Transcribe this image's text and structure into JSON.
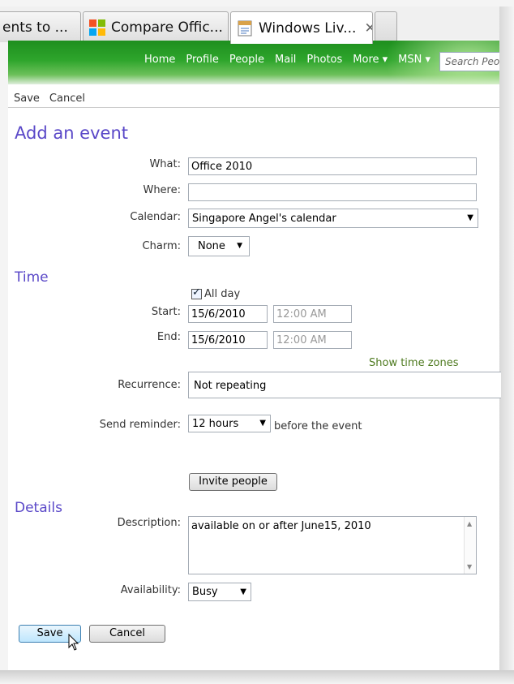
{
  "tabs": [
    {
      "title": "ents to ..."
    },
    {
      "title": "Compare Offic..."
    },
    {
      "title": "Windows Liv...",
      "close": "✕"
    }
  ],
  "nav": {
    "items": [
      "Home",
      "Profile",
      "People",
      "Mail",
      "Photos",
      "More ▾",
      "MSN ▾"
    ],
    "search_placeholder": "Search People"
  },
  "cmdbar": {
    "save": "Save",
    "cancel": "Cancel"
  },
  "page": {
    "heading": "Add an event"
  },
  "form": {
    "what_label": "What:",
    "what_value": "Office 2010",
    "where_label": "Where:",
    "where_value": "",
    "calendar_label": "Calendar:",
    "calendar_value": "Singapore Angel's calendar",
    "charm_label": "Charm:",
    "charm_value": "None"
  },
  "time": {
    "section": "Time",
    "all_day_label": "All day",
    "all_day_checked": true,
    "start_label": "Start:",
    "start_date": "15/6/2010",
    "start_time": "12:00 AM",
    "end_label": "End:",
    "end_date": "15/6/2010",
    "end_time": "12:00 AM",
    "show_time_zones": "Show time zones",
    "recurrence_label": "Recurrence:",
    "recurrence_value": "Not repeating",
    "reminder_label": "Send reminder:",
    "reminder_value": "12 hours",
    "reminder_suffix": "before the event",
    "invite_button": "Invite people"
  },
  "details": {
    "section": "Details",
    "description_label": "Description:",
    "description_value": "available on or after June15, 2010",
    "availability_label": "Availability:",
    "availability_value": "Busy"
  },
  "actions": {
    "save": "Save",
    "cancel": "Cancel"
  },
  "colors": {
    "accent_heading": "#5a48c8",
    "header_green": "#2ea52c",
    "link_green": "#4e7a1f"
  }
}
